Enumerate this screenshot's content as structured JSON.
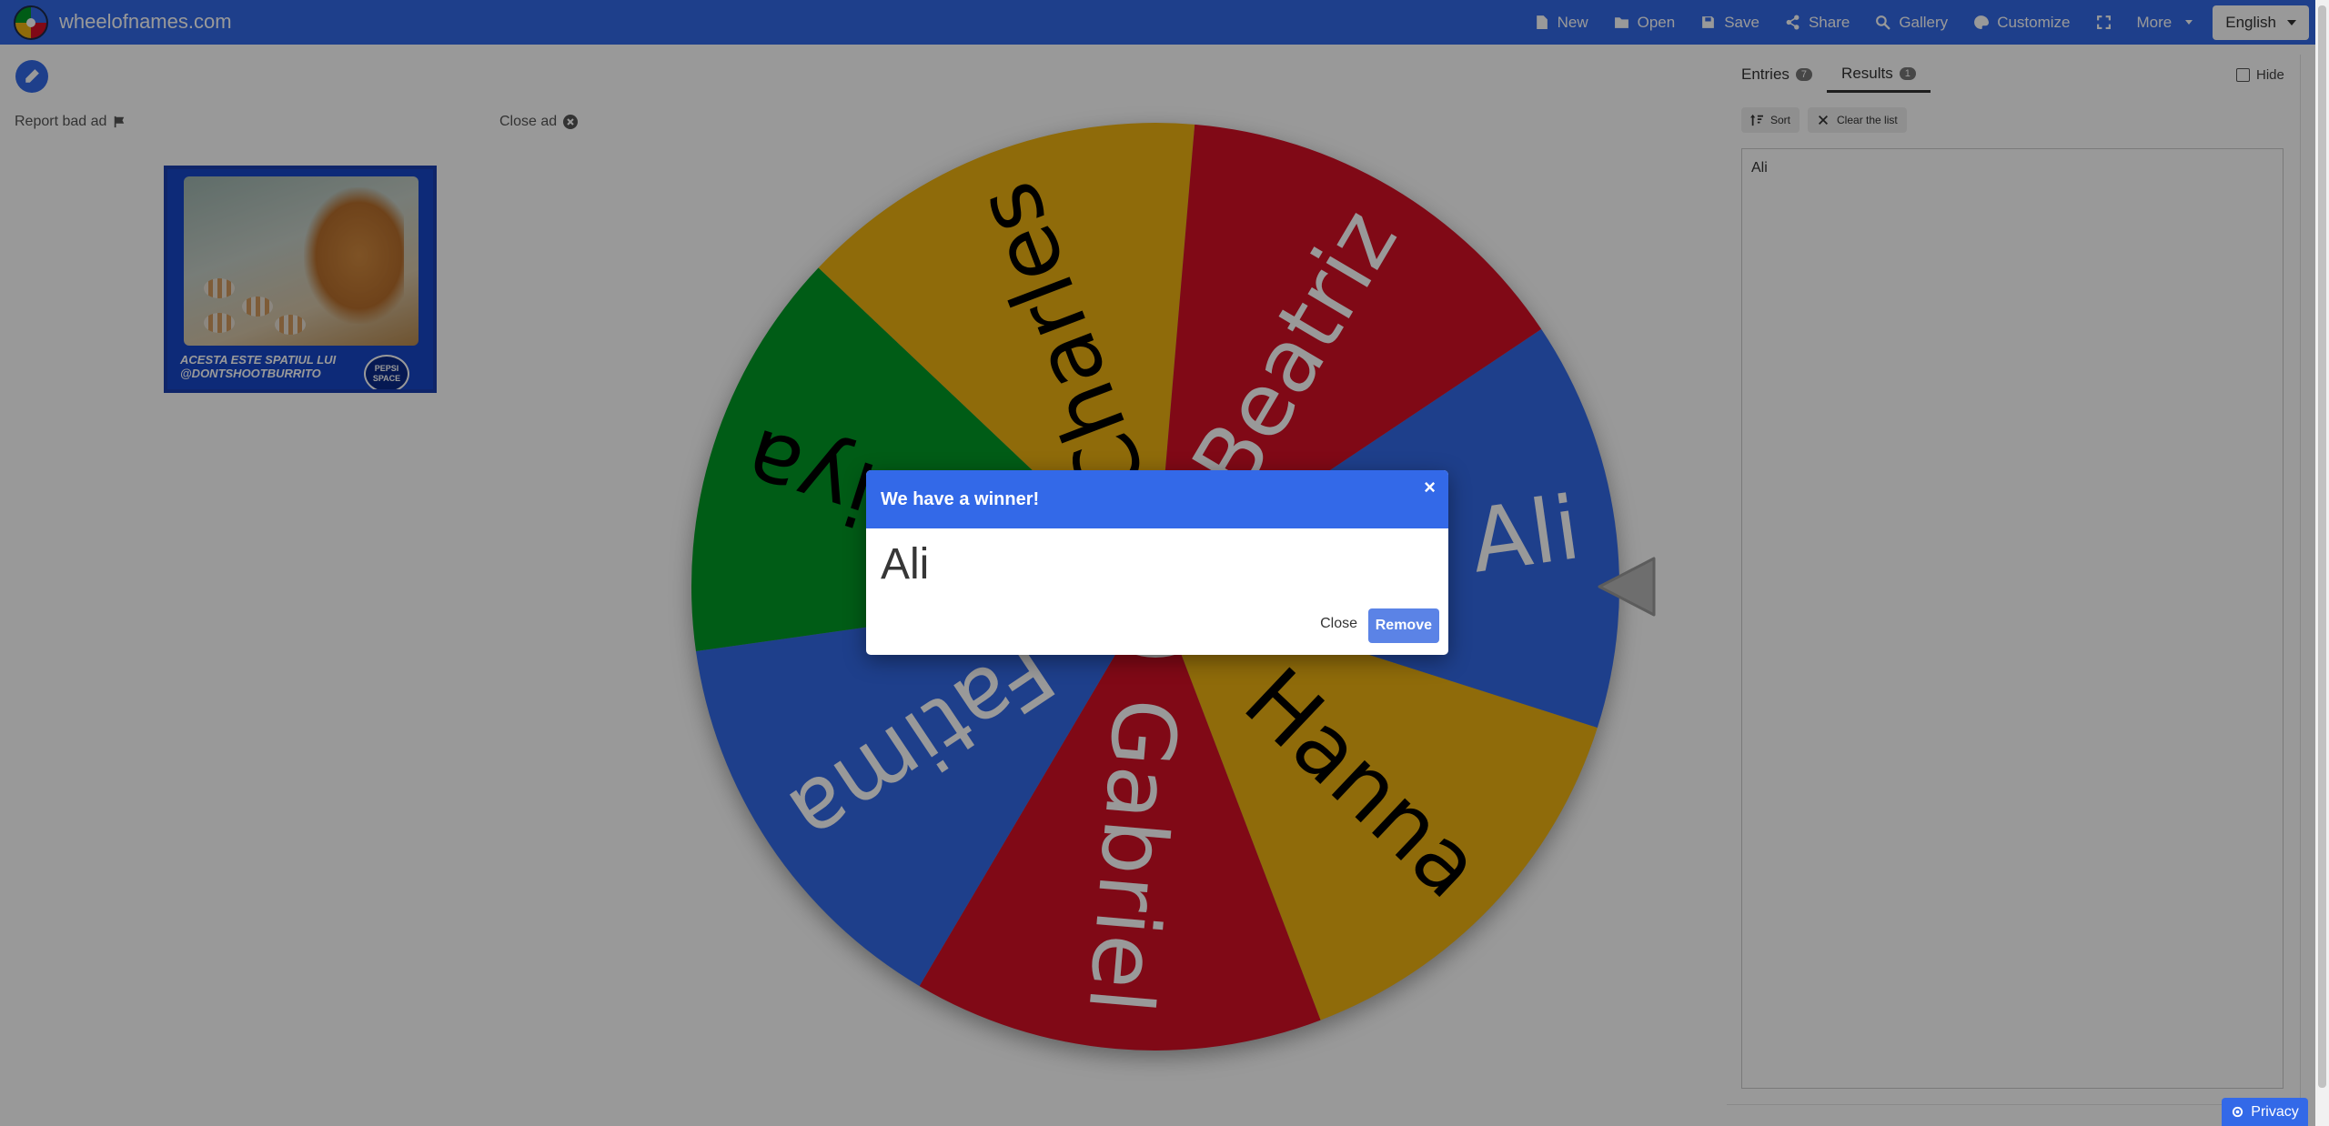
{
  "header": {
    "site_title": "wheelofnames.com",
    "nav": [
      {
        "label": "New",
        "icon": "file-icon"
      },
      {
        "label": "Open",
        "icon": "folder-open-icon"
      },
      {
        "label": "Save",
        "icon": "save-icon"
      },
      {
        "label": "Share",
        "icon": "share-icon"
      },
      {
        "label": "Gallery",
        "icon": "search-icon"
      },
      {
        "label": "Customize",
        "icon": "palette-icon"
      },
      {
        "label": "",
        "icon": "fullscreen-icon"
      },
      {
        "label": "More",
        "icon": "caret-down-icon"
      }
    ],
    "language": "English"
  },
  "ad": {
    "report_label": "Report bad ad",
    "close_label": "Close ad",
    "caption_line1": "ACESTA ESTE SPATIUL LUI",
    "caption_line2": "@DONTSHOOTBURRITO",
    "badge_line1": "PEPSI",
    "badge_line2": "SPACE"
  },
  "wheel": {
    "colors": {
      "blue": "#3369e8",
      "red": "#d50f25",
      "yellow": "#eeb211",
      "green": "#009925"
    },
    "segments": [
      {
        "label": "Ali",
        "color": "#3369e8",
        "text_color": "#ffffff"
      },
      {
        "label": "Hanna",
        "color": "#eeb211",
        "text_color": "#000000"
      },
      {
        "label": "Gabriel",
        "color": "#d50f25",
        "text_color": "#ffffff"
      },
      {
        "label": "Fatima",
        "color": "#3369e8",
        "text_color": "#ffffff"
      },
      {
        "label": "Diya",
        "color": "#009925",
        "text_color": "#000000"
      },
      {
        "label": "Charles",
        "color": "#eeb211",
        "text_color": "#000000"
      },
      {
        "label": "Beatriz",
        "color": "#d50f25",
        "text_color": "#ffffff"
      }
    ]
  },
  "panel": {
    "tabs": [
      {
        "label": "Entries",
        "count": "7"
      },
      {
        "label": "Results",
        "count": "1"
      }
    ],
    "hide_label": "Hide",
    "sort_label": "Sort",
    "clear_label": "Clear the list",
    "results_text": "Ali"
  },
  "modal": {
    "title": "We have a winner!",
    "winner": "Ali",
    "close_label": "Close",
    "remove_label": "Remove",
    "close_symbol": "×"
  },
  "footer": {
    "privacy_label": "Privacy"
  }
}
